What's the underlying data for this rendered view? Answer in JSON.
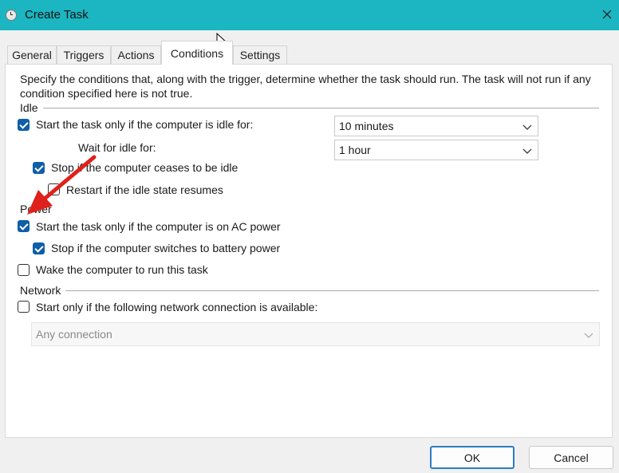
{
  "window": {
    "title": "Create Task",
    "icon": "clock-icon",
    "close_icon": "close-icon"
  },
  "tabs": [
    {
      "label": "General"
    },
    {
      "label": "Triggers"
    },
    {
      "label": "Actions"
    },
    {
      "label": "Conditions",
      "active": true
    },
    {
      "label": "Settings"
    }
  ],
  "description": "Specify the conditions that, along with the trigger, determine whether the task should run.  The task will not run  if any condition specified here is not true.",
  "idle": {
    "section_label": "Idle",
    "start_if_idle": {
      "label": "Start the task only if the computer is idle for:",
      "checked": true
    },
    "idle_for_value": "10 minutes",
    "wait_label": "Wait for idle for:",
    "wait_value": "1 hour",
    "stop_if_ceases": {
      "label": "Stop if the computer ceases to be idle",
      "checked": true
    },
    "restart_if_resumes": {
      "label": "Restart if the idle state resumes",
      "checked": false
    }
  },
  "power": {
    "section_label": "Power",
    "start_on_ac": {
      "label": "Start the task only if the computer is on AC power",
      "checked": true
    },
    "stop_on_battery": {
      "label": "Stop if the computer switches to battery power",
      "checked": true
    },
    "wake_to_run": {
      "label": "Wake the computer to run this task",
      "checked": false
    }
  },
  "network": {
    "section_label": "Network",
    "start_if_network": {
      "label": "Start only if the following network connection is available:",
      "checked": false
    },
    "connection_value": "Any connection"
  },
  "buttons": {
    "ok": "OK",
    "cancel": "Cancel"
  },
  "colors": {
    "titlebar": "#1bb6c1",
    "checkbox_checked": "#0f5ea8",
    "annotation_arrow": "#e0201b"
  }
}
